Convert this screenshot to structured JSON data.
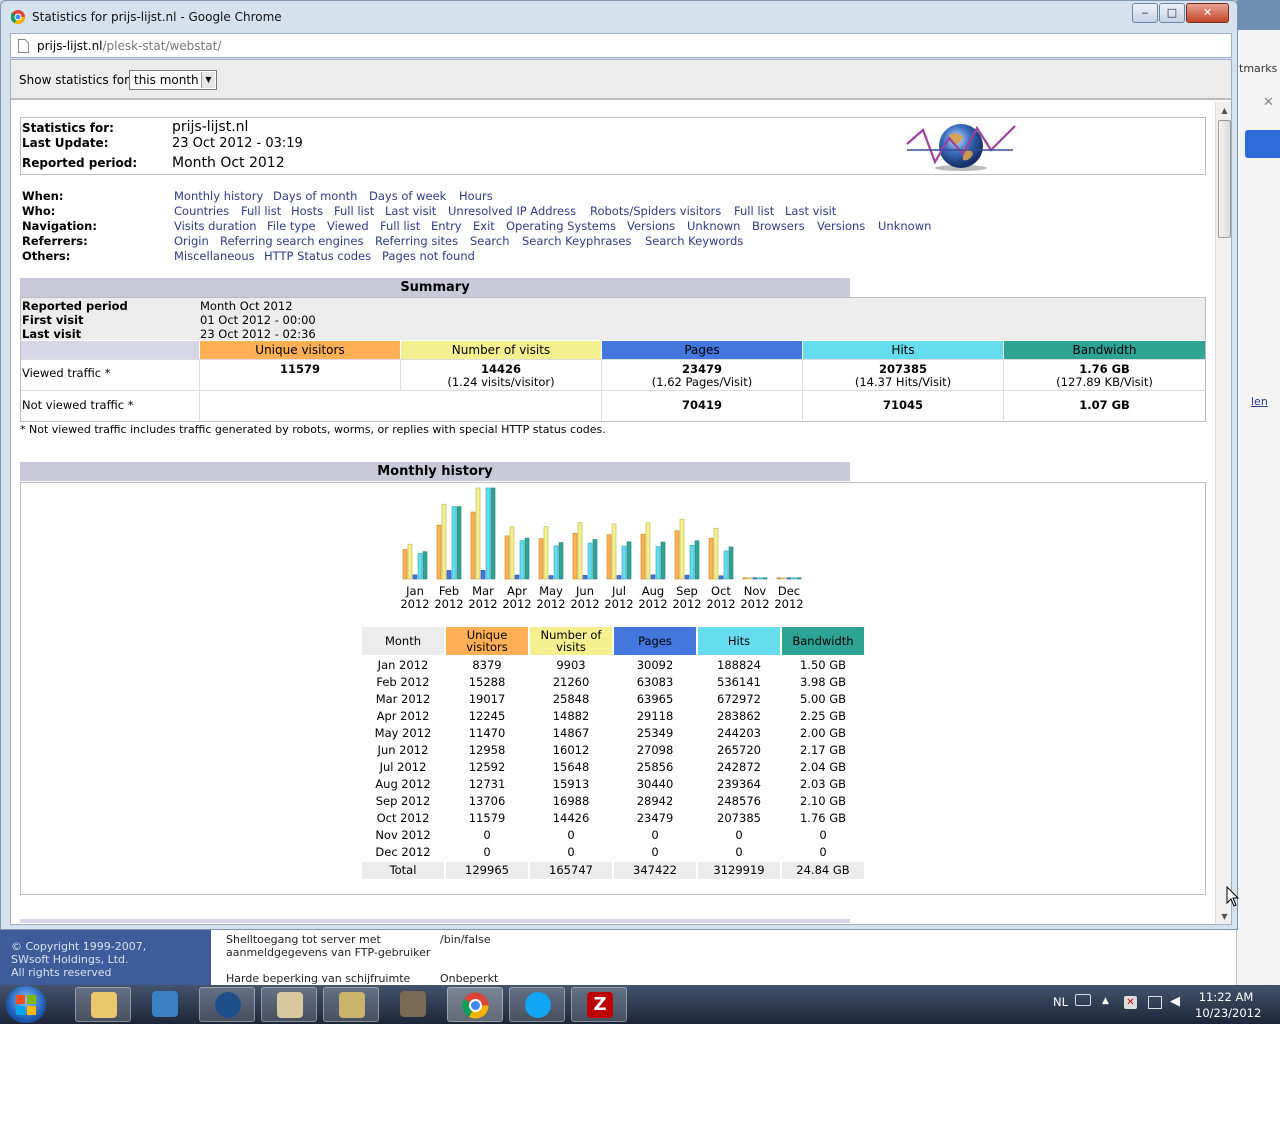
{
  "window": {
    "title": "Statistics for prijs-lijst.nl - Google Chrome",
    "url_host": "prijs-lijst.nl",
    "url_path": "/plesk-stat/webstat/"
  },
  "background_window": {
    "bookmarks_fragment": "tmarks",
    "link_fragment": "len",
    "copyright": [
      "© Copyright 1999-2007,",
      "SWsoft Holdings, Ltd.",
      "All rights reserved"
    ],
    "rows": [
      {
        "label1": "Shelltoegang tot server met",
        "label2": "aanmeldgegevens van FTP-gebruiker",
        "value": "/bin/false"
      },
      {
        "label1": "Harde beperking van schijfruimte",
        "label2": "",
        "value": "Onbeperkt"
      }
    ]
  },
  "toolbar": {
    "show_label": "Show statistics for",
    "period_value": "this month"
  },
  "info": {
    "stats_for_label": "Statistics for:",
    "stats_for_value": "prijs-lijst.nl",
    "last_update_label": "Last Update:",
    "last_update_value": "23 Oct 2012 - 03:19",
    "reported_label": "Reported period:",
    "reported_value": "Month Oct 2012"
  },
  "nav": {
    "when_label": "When:",
    "when": [
      "Monthly history",
      "Days of month",
      "Days of week",
      "Hours"
    ],
    "who_label": "Who:",
    "who": [
      "Countries",
      "Full list",
      "Hosts",
      "Full list",
      "Last visit",
      "Unresolved IP Address",
      "Robots/Spiders visitors",
      "Full list",
      "Last visit"
    ],
    "navigation_label": "Navigation:",
    "navigation": [
      "Visits duration",
      "File type",
      "Viewed",
      "Full list",
      "Entry",
      "Exit",
      "Operating Systems",
      "Versions",
      "Unknown",
      "Browsers",
      "Versions",
      "Unknown"
    ],
    "referrers_label": "Referrers:",
    "referrers": [
      "Origin",
      "Referring search engines",
      "Referring sites",
      "Search",
      "Search Keyphrases",
      "Search Keywords"
    ],
    "others_label": "Others:",
    "others": [
      "Miscellaneous",
      "HTTP Status codes",
      "Pages not found"
    ]
  },
  "summary": {
    "title": "Summary",
    "reported_period_label": "Reported period",
    "reported_period_value": "Month Oct 2012",
    "first_visit_label": "First visit",
    "first_visit_value": "01 Oct 2012 - 00:00",
    "last_visit_label": "Last visit",
    "last_visit_value": "23 Oct 2012 - 02:36",
    "headers": [
      "Unique visitors",
      "Number of visits",
      "Pages",
      "Hits",
      "Bandwidth"
    ],
    "viewed_label": "Viewed traffic *",
    "viewed": [
      "11579",
      "14426",
      "23479",
      "207385",
      "1.76 GB"
    ],
    "viewed_sub": [
      "",
      "(1.24 visits/visitor)",
      "(1.62 Pages/Visit)",
      "(14.37 Hits/Visit)",
      "(127.89 KB/Visit)"
    ],
    "not_viewed_label": "Not viewed traffic *",
    "not_viewed": [
      "",
      "",
      "70419",
      "71045",
      "1.07 GB"
    ],
    "footnote": "* Not viewed traffic includes traffic generated by robots, worms, or replies with special HTTP status codes."
  },
  "monthly": {
    "title": "Monthly history",
    "headers": [
      "Month",
      "Unique visitors",
      "Number of visits",
      "Pages",
      "Hits",
      "Bandwidth"
    ],
    "rows": [
      [
        "Jan 2012",
        "8379",
        "9903",
        "30092",
        "188824",
        "1.50 GB"
      ],
      [
        "Feb 2012",
        "15288",
        "21260",
        "63083",
        "536141",
        "3.98 GB"
      ],
      [
        "Mar 2012",
        "19017",
        "25848",
        "63965",
        "672972",
        "5.00 GB"
      ],
      [
        "Apr 2012",
        "12245",
        "14882",
        "29118",
        "283862",
        "2.25 GB"
      ],
      [
        "May 2012",
        "11470",
        "14867",
        "25349",
        "244203",
        "2.00 GB"
      ],
      [
        "Jun 2012",
        "12958",
        "16012",
        "27098",
        "265720",
        "2.17 GB"
      ],
      [
        "Jul 2012",
        "12592",
        "15648",
        "25856",
        "242872",
        "2.04 GB"
      ],
      [
        "Aug 2012",
        "12731",
        "15913",
        "30440",
        "239364",
        "2.03 GB"
      ],
      [
        "Sep 2012",
        "13706",
        "16988",
        "28942",
        "248576",
        "2.10 GB"
      ],
      [
        "Oct 2012",
        "11579",
        "14426",
        "23479",
        "207385",
        "1.76 GB"
      ],
      [
        "Nov 2012",
        "0",
        "0",
        "0",
        "0",
        "0"
      ],
      [
        "Dec 2012",
        "0",
        "0",
        "0",
        "0",
        "0"
      ]
    ],
    "total": [
      "Total",
      "129965",
      "165747",
      "347422",
      "3129919",
      "24.84 GB"
    ]
  },
  "chart_data": {
    "type": "bar",
    "categories": [
      "Jan 2012",
      "Feb 2012",
      "Mar 2012",
      "Apr 2012",
      "May 2012",
      "Jun 2012",
      "Jul 2012",
      "Aug 2012",
      "Sep 2012",
      "Oct 2012",
      "Nov 2012",
      "Dec 2012"
    ],
    "month_labels": [
      "Jan",
      "Feb",
      "Mar",
      "Apr",
      "May",
      "Jun",
      "Jul",
      "Aug",
      "Sep",
      "Oct",
      "Nov",
      "Dec"
    ],
    "year_labels": [
      "2012",
      "2012",
      "2012",
      "2012",
      "2012",
      "2012",
      "2012",
      "2012",
      "2012",
      "2012",
      "2012",
      "2012"
    ],
    "series": [
      {
        "key": "unique",
        "color": "#ffb055",
        "values": [
          8379,
          15288,
          19017,
          12245,
          11470,
          12958,
          12592,
          12731,
          13706,
          11579,
          0,
          0
        ]
      },
      {
        "key": "visits",
        "color": "#f4f090",
        "values": [
          9903,
          21260,
          25848,
          14882,
          14867,
          16012,
          15648,
          15913,
          16988,
          14426,
          0,
          0
        ]
      },
      {
        "key": "pages",
        "color": "#4477dd",
        "values": [
          30092,
          63083,
          63965,
          29118,
          25349,
          27098,
          25856,
          30440,
          28942,
          23479,
          0,
          0
        ]
      },
      {
        "key": "hits",
        "color": "#66ddee",
        "values": [
          188824,
          536141,
          672972,
          283862,
          244203,
          265720,
          242872,
          239364,
          248576,
          207385,
          0,
          0
        ]
      },
      {
        "key": "bandwidth_gb",
        "color": "#2ea495",
        "values": [
          1.5,
          3.98,
          5.0,
          2.25,
          2.0,
          2.17,
          2.04,
          2.03,
          2.1,
          1.76,
          0,
          0
        ]
      }
    ]
  },
  "taskbar": {
    "lang": "NL",
    "time": "11:22 AM",
    "date": "10/23/2012",
    "apps": [
      "file-explorer-icon",
      "media-player-icon",
      "app-blue-icon",
      "paint-icon",
      "remote-desktop-icon",
      "gimp-icon",
      "chrome-icon",
      "skype-icon",
      "filezilla-icon"
    ]
  }
}
